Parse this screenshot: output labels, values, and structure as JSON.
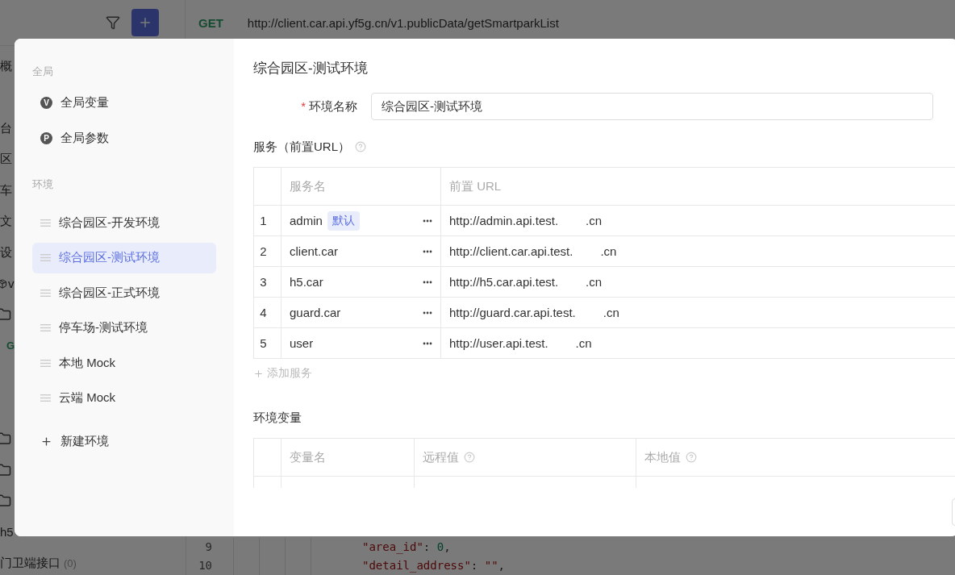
{
  "background": {
    "toolbar": {
      "method": "GET",
      "url": "http://client.car.api.yf5g.cn/v1.publicData/getSmartparkList"
    },
    "sidebar_fragments": [
      {
        "kind": "text",
        "text": "概"
      },
      {
        "kind": "gap"
      },
      {
        "kind": "text",
        "text": "台"
      },
      {
        "kind": "text",
        "text": "区"
      },
      {
        "kind": "text",
        "text": "车"
      },
      {
        "kind": "text",
        "text": "文"
      },
      {
        "kind": "text",
        "text": "设"
      },
      {
        "kind": "repo",
        "text": "v"
      },
      {
        "kind": "folder"
      },
      {
        "kind": "method",
        "text": "G"
      },
      {
        "kind": "gap"
      },
      {
        "kind": "gap"
      },
      {
        "kind": "folder"
      },
      {
        "kind": "folder"
      },
      {
        "kind": "folder"
      },
      {
        "kind": "text",
        "text": "h5"
      },
      {
        "kind": "count",
        "text": "门卫端接口",
        "count": "(0)"
      }
    ],
    "code_lines": [
      {
        "number": "9",
        "parts": [
          {
            "kind": "key",
            "text": "\"area_id\""
          },
          {
            "kind": "punct",
            "text": ": "
          },
          {
            "kind": "number",
            "text": "0"
          },
          {
            "kind": "punct",
            "text": ","
          }
        ]
      },
      {
        "number": "10",
        "parts": [
          {
            "kind": "key",
            "text": "\"detail_address\""
          },
          {
            "kind": "punct",
            "text": ": "
          },
          {
            "kind": "string",
            "text": "\"\""
          },
          {
            "kind": "punct",
            "text": ","
          }
        ]
      }
    ]
  },
  "modal": {
    "nav": {
      "global_heading": "全局",
      "global_items": [
        {
          "badge": "V",
          "label": "全局变量"
        },
        {
          "badge": "P",
          "label": "全局参数"
        }
      ],
      "env_heading": "环境",
      "environments": [
        {
          "name": "综合园区-开发环境",
          "selected": false
        },
        {
          "name": "综合园区-测试环境",
          "selected": true
        },
        {
          "name": "综合园区-正式环境",
          "selected": false
        },
        {
          "name": "停车场-测试环境",
          "selected": false
        },
        {
          "name": "本地 Mock",
          "selected": false
        },
        {
          "name": "云端 Mock",
          "selected": false
        }
      ],
      "new_env": "新建环境"
    },
    "title": "综合园区-测试环境",
    "name_field": {
      "required_mark": "*",
      "label": "环境名称",
      "value": "综合园区-测试环境"
    },
    "services_heading": "服务（前置URL）",
    "services_columns": [
      "服务名",
      "前置 URL"
    ],
    "services": [
      {
        "index": "1",
        "name": "admin",
        "default": true,
        "badge": "默认",
        "url_prefix": "http://admin.api.test.",
        "url_suffix": ".cn"
      },
      {
        "index": "2",
        "name": "client.car",
        "default": false,
        "url_prefix": "http://client.car.api.test.",
        "url_suffix": ".cn"
      },
      {
        "index": "3",
        "name": "h5.car",
        "default": false,
        "url_prefix": "http://h5.car.api.test.",
        "url_suffix": ".cn"
      },
      {
        "index": "4",
        "name": "guard.car",
        "default": false,
        "url_prefix": "http://guard.car.api.test.",
        "url_suffix": ".cn"
      },
      {
        "index": "5",
        "name": "user",
        "default": false,
        "url_prefix": "http://user.api.test.",
        "url_suffix": ".cn"
      }
    ],
    "add_service": "添加服务",
    "variables_heading": "环境变量",
    "variables_columns": [
      {
        "label": "变量名",
        "help": false
      },
      {
        "label": "远程值",
        "help": true
      },
      {
        "label": "本地值",
        "help": true
      }
    ]
  }
}
